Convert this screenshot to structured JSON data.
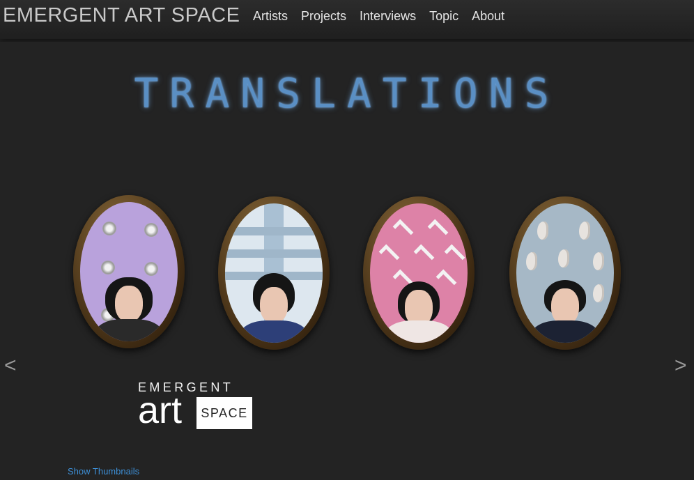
{
  "header": {
    "brand": "EMERGENT ART SPACE",
    "nav": [
      "Artists",
      "Projects",
      "Interviews",
      "Topic",
      "About"
    ]
  },
  "slide": {
    "title": "TRANSLATIONS",
    "portraits": [
      {
        "background": "lavender",
        "color": "#b9a2dc",
        "decoration": "telephone-dials"
      },
      {
        "background": "pale-blue-grid",
        "color": "#dde7ef",
        "decoration": "stripes"
      },
      {
        "background": "pink",
        "color": "#dd82a7",
        "decoration": "chevrons"
      },
      {
        "background": "blue-grey",
        "color": "#a6b8c6",
        "decoration": "ears"
      }
    ],
    "prev_icon": "<",
    "next_icon": ">"
  },
  "logo": {
    "line1": "EMERGENT",
    "art": "art",
    "space": "SPACE"
  },
  "footer": {
    "show_thumbnails": "Show Thumbnails"
  },
  "colors": {
    "background": "#232323",
    "title_glow": "#5a8fc4",
    "link": "#3d8fd6"
  }
}
